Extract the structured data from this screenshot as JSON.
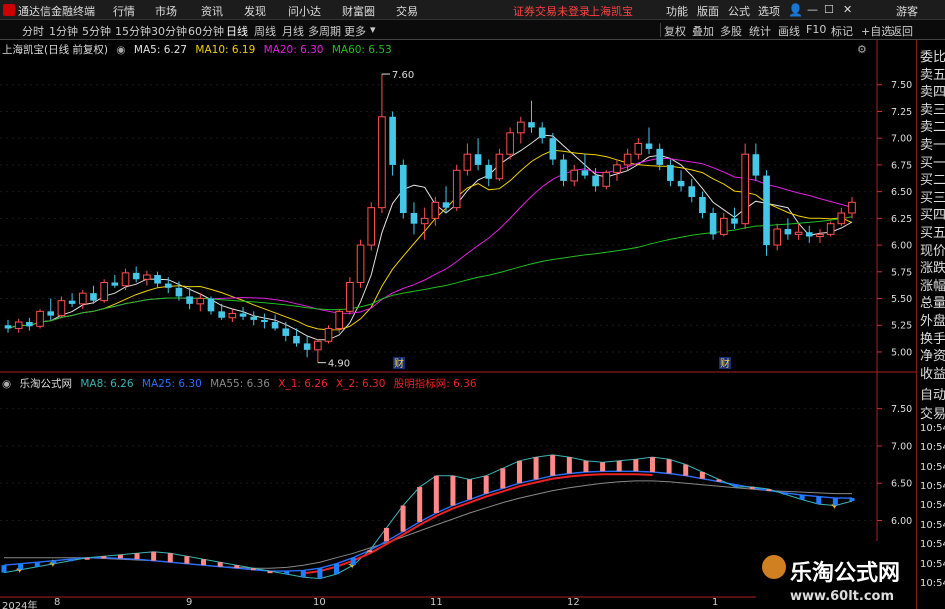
{
  "menubar": {
    "app_title": "通达信金融终端",
    "items": [
      "行情",
      "市场",
      "资讯",
      "发现",
      "问小达",
      "财富圈",
      "交易"
    ],
    "notice_left": "证券交易未登录",
    "notice_right": "上海凯宝",
    "right_items": [
      "功能",
      "版面",
      "公式",
      "选项"
    ],
    "guest": "游客"
  },
  "toolbar": {
    "periods": [
      "分时",
      "1分钟",
      "5分钟",
      "15分钟",
      "30分钟",
      "60分钟",
      "日线",
      "周线",
      "月线",
      "多周期",
      "更多"
    ],
    "active": "日线",
    "right": [
      "复权",
      "叠加",
      "多股",
      "统计",
      "画线",
      "F10",
      "标记",
      "+自选",
      "返回"
    ]
  },
  "main_info": {
    "title": "上海凯宝(日线 前复权)",
    "ma5": "MA5: 6.27",
    "ma10": "MA10: 6.19",
    "ma20": "MA20: 6.30",
    "ma60": "MA60: 6.53"
  },
  "sub_info": {
    "title": "乐淘公式网",
    "ma8": "MA8: 6.26",
    "ma25": "MA25: 6.30",
    "ma55": "MA55: 6.36",
    "x1": "X_1: 6.26",
    "x2": "X_2: 6.30",
    "signal": "股明指标网: 6.36"
  },
  "sidebar": [
    "委比",
    "卖五",
    "卖四",
    "卖三",
    "卖二",
    "卖一",
    "买一",
    "买二",
    "买三",
    "买四",
    "买五",
    "现价",
    "涨跌",
    "涨幅",
    "总量",
    "外盘",
    "换手",
    "净资",
    "收益",
    "自动",
    "交易",
    "10:54",
    "10:54",
    "10:54",
    "10:54",
    "10:54",
    "10:54",
    "10:54",
    "10:54",
    "10:54"
  ],
  "annotations": {
    "high": "7.60",
    "low": "4.90",
    "fin1": "财",
    "fin2": "财"
  },
  "dates": [
    "2024年",
    "8",
    "9",
    "10",
    "11",
    "12",
    "1"
  ],
  "watermark": {
    "text": "乐淘公式网",
    "url": "www.60lt.com"
  },
  "colors": {
    "up": "#ff5050",
    "down": "#45c8e8",
    "ma5": "#e0e0e0",
    "ma10": "#f0d000",
    "ma20": "#e020e0",
    "ma60": "#20c020",
    "sub_ma8": "#3ab4b4",
    "sub_ma25": "#2a6fff",
    "sub_ma55": "#888888",
    "sub_x2": "#ee2222",
    "sub_bar_up": "#ff8888",
    "sub_bar_down": "#1e7fff"
  },
  "chart_data": [
    {
      "type": "candlestick",
      "title": "上海凯宝(日线 前复权)",
      "ylim": [
        4.85,
        7.75
      ],
      "yticks": [
        "7.50",
        "7.25",
        "7.00",
        "6.75",
        "6.50",
        "6.25",
        "6.00",
        "5.75",
        "5.50",
        "5.25",
        "5.00"
      ],
      "ohlc": [
        [
          5.25,
          5.3,
          5.18,
          5.22
        ],
        [
          5.22,
          5.31,
          5.18,
          5.28
        ],
        [
          5.28,
          5.32,
          5.2,
          5.24
        ],
        [
          5.24,
          5.4,
          5.22,
          5.38
        ],
        [
          5.38,
          5.5,
          5.3,
          5.34
        ],
        [
          5.34,
          5.52,
          5.32,
          5.48
        ],
        [
          5.48,
          5.55,
          5.42,
          5.45
        ],
        [
          5.45,
          5.58,
          5.4,
          5.55
        ],
        [
          5.55,
          5.62,
          5.45,
          5.48
        ],
        [
          5.48,
          5.68,
          5.46,
          5.65
        ],
        [
          5.65,
          5.72,
          5.6,
          5.62
        ],
        [
          5.62,
          5.78,
          5.58,
          5.74
        ],
        [
          5.74,
          5.8,
          5.65,
          5.68
        ],
        [
          5.68,
          5.76,
          5.62,
          5.72
        ],
        [
          5.72,
          5.75,
          5.6,
          5.64
        ],
        [
          5.64,
          5.7,
          5.55,
          5.6
        ],
        [
          5.6,
          5.66,
          5.48,
          5.52
        ],
        [
          5.52,
          5.6,
          5.4,
          5.45
        ],
        [
          5.45,
          5.55,
          5.38,
          5.5
        ],
        [
          5.5,
          5.52,
          5.35,
          5.38
        ],
        [
          5.38,
          5.45,
          5.3,
          5.32
        ],
        [
          5.32,
          5.4,
          5.28,
          5.36
        ],
        [
          5.36,
          5.42,
          5.3,
          5.33
        ],
        [
          5.33,
          5.38,
          5.25,
          5.3
        ],
        [
          5.3,
          5.36,
          5.22,
          5.28
        ],
        [
          5.28,
          5.35,
          5.2,
          5.22
        ],
        [
          5.22,
          5.28,
          5.1,
          5.15
        ],
        [
          5.15,
          5.22,
          5.05,
          5.08
        ],
        [
          5.08,
          5.15,
          4.95,
          5.02
        ],
        [
          5.02,
          5.12,
          4.9,
          5.1
        ],
        [
          5.1,
          5.25,
          5.08,
          5.22
        ],
        [
          5.22,
          5.4,
          5.18,
          5.38
        ],
        [
          5.38,
          5.7,
          5.35,
          5.65
        ],
        [
          5.65,
          6.05,
          5.6,
          6.0
        ],
        [
          6.0,
          6.4,
          5.95,
          6.35
        ],
        [
          6.35,
          7.6,
          6.3,
          7.2
        ],
        [
          7.2,
          7.25,
          6.65,
          6.75
        ],
        [
          6.75,
          6.8,
          6.25,
          6.3
        ],
        [
          6.3,
          6.4,
          6.1,
          6.2
        ],
        [
          6.2,
          6.35,
          6.05,
          6.25
        ],
        [
          6.25,
          6.45,
          6.18,
          6.4
        ],
        [
          6.4,
          6.55,
          6.3,
          6.35
        ],
        [
          6.35,
          6.75,
          6.32,
          6.7
        ],
        [
          6.7,
          6.95,
          6.65,
          6.85
        ],
        [
          6.85,
          7.0,
          6.7,
          6.75
        ],
        [
          6.75,
          6.8,
          6.55,
          6.62
        ],
        [
          6.62,
          6.9,
          6.6,
          6.85
        ],
        [
          6.85,
          7.1,
          6.8,
          7.05
        ],
        [
          7.05,
          7.2,
          6.95,
          7.15
        ],
        [
          7.15,
          7.35,
          7.05,
          7.1
        ],
        [
          7.1,
          7.15,
          6.95,
          7.0
        ],
        [
          7.0,
          7.05,
          6.75,
          6.8
        ],
        [
          6.8,
          6.85,
          6.55,
          6.6
        ],
        [
          6.6,
          6.75,
          6.55,
          6.7
        ],
        [
          6.7,
          6.85,
          6.62,
          6.65
        ],
        [
          6.65,
          6.72,
          6.5,
          6.55
        ],
        [
          6.55,
          6.7,
          6.52,
          6.68
        ],
        [
          6.68,
          6.8,
          6.6,
          6.75
        ],
        [
          6.75,
          6.9,
          6.7,
          6.85
        ],
        [
          6.85,
          7.0,
          6.8,
          6.95
        ],
        [
          6.95,
          7.1,
          6.85,
          6.9
        ],
        [
          6.9,
          6.95,
          6.7,
          6.75
        ],
        [
          6.75,
          6.8,
          6.55,
          6.6
        ],
        [
          6.6,
          6.7,
          6.5,
          6.55
        ],
        [
          6.55,
          6.62,
          6.4,
          6.45
        ],
        [
          6.45,
          6.5,
          6.25,
          6.3
        ],
        [
          6.3,
          6.35,
          6.05,
          6.1
        ],
        [
          6.1,
          6.3,
          6.08,
          6.25
        ],
        [
          6.25,
          6.35,
          6.15,
          6.2
        ],
        [
          6.2,
          6.95,
          6.15,
          6.85
        ],
        [
          6.85,
          6.95,
          6.6,
          6.65
        ],
        [
          6.65,
          6.7,
          5.9,
          6.0
        ],
        [
          6.0,
          6.2,
          5.95,
          6.15
        ],
        [
          6.15,
          6.25,
          6.05,
          6.1
        ],
        [
          6.1,
          6.2,
          6.05,
          6.12
        ],
        [
          6.12,
          6.18,
          6.02,
          6.08
        ],
        [
          6.08,
          6.15,
          6.02,
          6.1
        ],
        [
          6.1,
          6.22,
          6.08,
          6.2
        ],
        [
          6.2,
          6.35,
          6.18,
          6.3
        ],
        [
          6.3,
          6.45,
          6.25,
          6.4
        ]
      ]
    },
    {
      "type": "line",
      "title": "乐淘公式网",
      "ylim": [
        5.0,
        7.75
      ],
      "yticks": [
        "7.50",
        "7.00",
        "6.50",
        "6.00"
      ],
      "series": [
        {
          "name": "MA8",
          "values": [
            5.3,
            5.34,
            5.38,
            5.42,
            5.46,
            5.5,
            5.52,
            5.54,
            5.56,
            5.58,
            5.56,
            5.52,
            5.48,
            5.44,
            5.4,
            5.36,
            5.32,
            5.28,
            5.24,
            5.22,
            5.28,
            5.4,
            5.6,
            5.9,
            6.2,
            6.45,
            6.6,
            6.6,
            6.55,
            6.6,
            6.7,
            6.8,
            6.85,
            6.88,
            6.85,
            6.8,
            6.78,
            6.8,
            6.82,
            6.85,
            6.82,
            6.75,
            6.65,
            6.55,
            6.45,
            6.45,
            6.42,
            6.35,
            6.28,
            6.22,
            6.2,
            6.26
          ]
        },
        {
          "name": "MA25",
          "values": [
            5.4,
            5.42,
            5.44,
            5.46,
            5.48,
            5.5,
            5.5,
            5.49,
            5.48,
            5.46,
            5.44,
            5.42,
            5.4,
            5.38,
            5.36,
            5.34,
            5.32,
            5.32,
            5.33,
            5.36,
            5.42,
            5.5,
            5.6,
            5.72,
            5.85,
            5.98,
            6.1,
            6.2,
            6.28,
            6.36,
            6.43,
            6.5,
            6.55,
            6.6,
            6.63,
            6.65,
            6.66,
            6.66,
            6.66,
            6.65,
            6.63,
            6.6,
            6.56,
            6.52,
            6.48,
            6.44,
            6.4,
            6.37,
            6.34,
            6.32,
            6.3,
            6.3
          ]
        },
        {
          "name": "MA55",
          "values": [
            5.5,
            5.5,
            5.5,
            5.5,
            5.5,
            5.5,
            5.49,
            5.48,
            5.47,
            5.46,
            5.44,
            5.42,
            5.4,
            5.38,
            5.37,
            5.36,
            5.36,
            5.37,
            5.4,
            5.44,
            5.5,
            5.56,
            5.63,
            5.7,
            5.78,
            5.86,
            5.94,
            6.02,
            6.1,
            6.17,
            6.24,
            6.3,
            6.35,
            6.4,
            6.44,
            6.47,
            6.5,
            6.52,
            6.53,
            6.53,
            6.52,
            6.5,
            6.48,
            6.46,
            6.44,
            6.42,
            6.4,
            6.39,
            6.38,
            6.37,
            6.36,
            6.36
          ]
        }
      ]
    }
  ]
}
